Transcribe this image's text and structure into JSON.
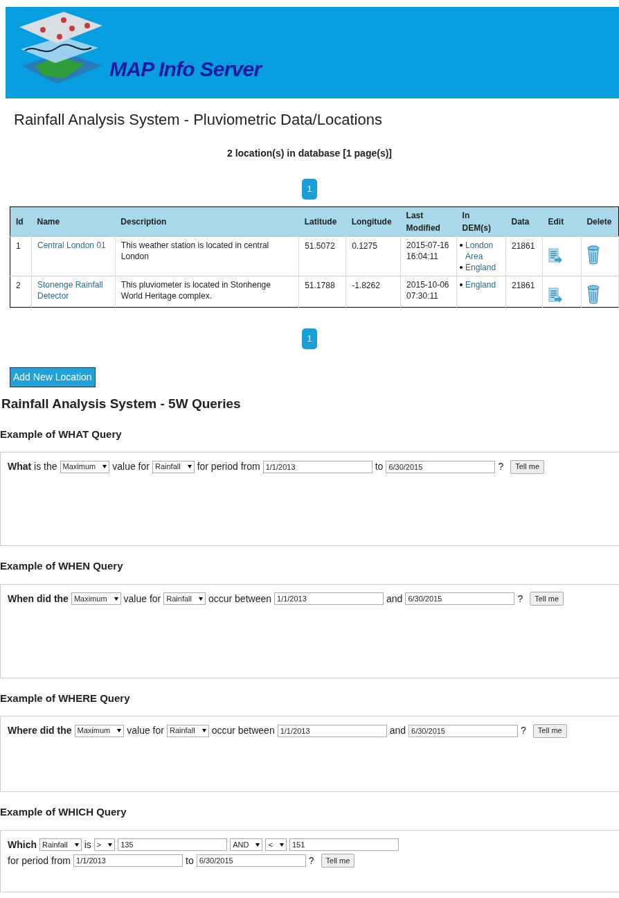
{
  "header": {
    "site_title": "MAP Info Server"
  },
  "locations": {
    "heading": "Rainfall Analysis System - Pluviometric Data/Locations",
    "count": "2 location(s) in database [1 page(s)]",
    "pagination_top": [
      {
        "label": "1",
        "selected": true
      }
    ],
    "table": {
      "columns": [
        "Id",
        "Name",
        "Description",
        "Latitude",
        "Longitude",
        "Last Modified",
        "In DEM(s)",
        "Data",
        "Edit",
        "Delete"
      ],
      "rows": [
        {
          "id": "1",
          "name": "Central London 01",
          "description": "This weather station is located in central London",
          "latitude": "51.5072",
          "longitude": "0.1275",
          "last_modified": "2015-07-16 16:04:11",
          "dems": [
            "London Area",
            "England"
          ],
          "data": "21861"
        },
        {
          "id": "2",
          "name": "Stonenge Rainfall Detector",
          "description": "This pluviometer is located in Stonhenge World Heritage complex.",
          "latitude": "51.1788",
          "longitude": "-1.8262",
          "last_modified": "2015-10-06 07:30:11",
          "dems": [
            "England"
          ],
          "data": "21861"
        }
      ]
    },
    "pagination_bottom": [
      {
        "label": "1",
        "selected": true
      }
    ],
    "add_button": "Add New Location"
  },
  "queries": {
    "heading": "Rainfall Analysis System - 5W Queries",
    "items": [
      {
        "title": "Example of WHAT Query",
        "parts": [
          {
            "kind": "text",
            "text": "**What** is the"
          },
          {
            "kind": "select",
            "value": "Maximum"
          },
          {
            "kind": "text",
            "text": "value for"
          },
          {
            "kind": "select",
            "value": "Rainfall"
          },
          {
            "kind": "text",
            "text": "for period from"
          },
          {
            "kind": "input",
            "value": "1/1/2013"
          },
          {
            "kind": "text",
            "text": "to"
          },
          {
            "kind": "input",
            "value": "6/30/2015"
          },
          {
            "kind": "text",
            "text": "?"
          },
          {
            "kind": "button",
            "text": "Tell me"
          }
        ]
      },
      {
        "title": "Example of WHEN Query",
        "parts": [
          {
            "kind": "text",
            "text": "When did the",
            "bold": true
          },
          {
            "kind": "select",
            "value": "Maximum"
          },
          {
            "kind": "text",
            "text": "value for"
          },
          {
            "kind": "select",
            "value": "Rainfall"
          },
          {
            "kind": "text",
            "text": "occur between"
          },
          {
            "kind": "input",
            "value": "1/1/2013"
          },
          {
            "kind": "text",
            "text": "and"
          },
          {
            "kind": "input",
            "value": "6/30/2015"
          },
          {
            "kind": "text",
            "text": "?"
          },
          {
            "kind": "button",
            "text": "Tell me"
          }
        ]
      },
      {
        "title": "Example of WHERE Query",
        "parts": [
          {
            "kind": "text",
            "text": "Where did the",
            "bold": true
          },
          {
            "kind": "select",
            "value": "Maximum"
          },
          {
            "kind": "text",
            "text": "value for"
          },
          {
            "kind": "select",
            "value": "Rainfall"
          },
          {
            "kind": "text",
            "text": "occur between"
          },
          {
            "kind": "input",
            "value": "1/1/2013"
          },
          {
            "kind": "text",
            "text": "and"
          },
          {
            "kind": "input",
            "value": "6/30/2015"
          },
          {
            "kind": "text",
            "text": "?"
          },
          {
            "kind": "button",
            "text": "Tell me"
          }
        ]
      },
      {
        "title": "Example of WHICH Query",
        "parts": [
          {
            "kind": "text",
            "text": "Which",
            "bold": true
          },
          {
            "kind": "select",
            "value": "Rainfall"
          },
          {
            "kind": "text",
            "text": "is"
          },
          {
            "kind": "select",
            "value": ">"
          },
          {
            "kind": "input",
            "value": "135"
          },
          {
            "kind": "select",
            "value": "AND"
          },
          {
            "kind": "select",
            "value": "<"
          },
          {
            "kind": "input",
            "value": "151"
          },
          {
            "kind": "break"
          },
          {
            "kind": "text",
            "text": "for period from"
          },
          {
            "kind": "input",
            "value": "1/1/2013"
          },
          {
            "kind": "text",
            "text": "to"
          },
          {
            "kind": "input",
            "value": "6/30/2015"
          },
          {
            "kind": "text",
            "text": "?"
          },
          {
            "kind": "button",
            "text": "Tell me"
          }
        ]
      }
    ]
  }
}
